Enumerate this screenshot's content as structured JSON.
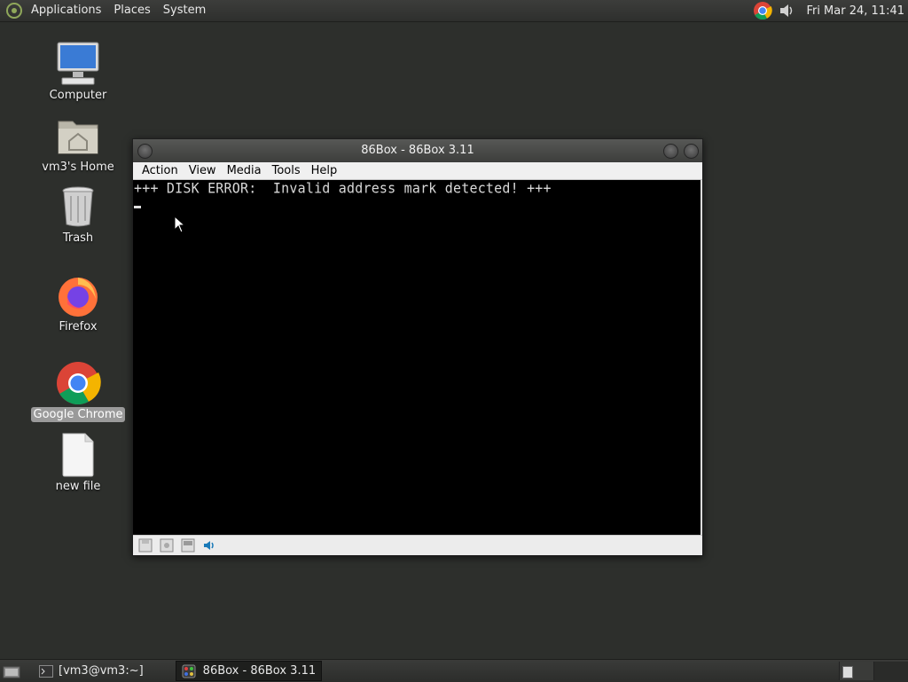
{
  "top_panel": {
    "menus": [
      "Applications",
      "Places",
      "System"
    ],
    "clock": "Fri Mar 24, 11:41"
  },
  "desktop": {
    "icons": [
      {
        "label": "Computer"
      },
      {
        "label": "vm3's Home"
      },
      {
        "label": "Trash"
      },
      {
        "label": "Firefox"
      },
      {
        "label": "Google Chrome",
        "selected": true
      },
      {
        "label": "new file"
      }
    ]
  },
  "window": {
    "title": "86Box - 86Box 3.11",
    "menu": [
      "Action",
      "View",
      "Media",
      "Tools",
      "Help"
    ],
    "screen_text": "+++ DISK ERROR:  Invalid address mark detected! +++"
  },
  "taskbar": {
    "items": [
      {
        "label": "[vm3@vm3:~]"
      },
      {
        "label": "86Box - 86Box 3.11",
        "active": true
      }
    ]
  }
}
